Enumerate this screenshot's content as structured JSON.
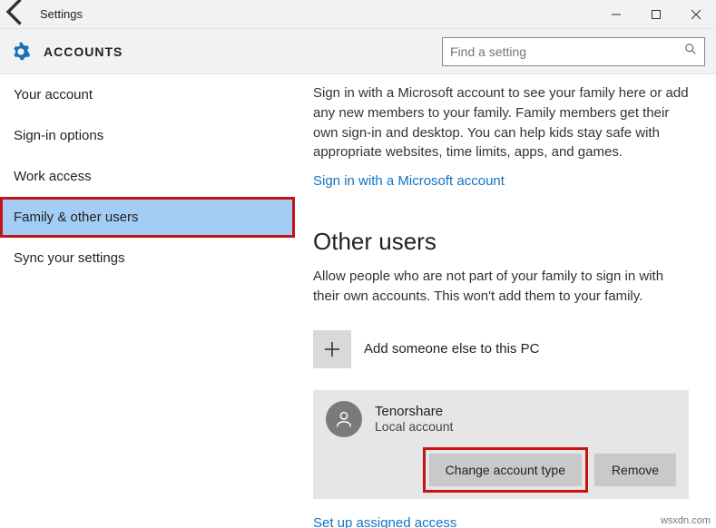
{
  "window": {
    "title": "Settings"
  },
  "header": {
    "category": "ACCOUNTS",
    "search_placeholder": "Find a setting"
  },
  "sidebar": {
    "items": [
      {
        "label": "Your account"
      },
      {
        "label": "Sign-in options"
      },
      {
        "label": "Work access"
      },
      {
        "label": "Family & other users"
      },
      {
        "label": "Sync your settings"
      }
    ]
  },
  "content": {
    "intro": "Sign in with a Microsoft account to see your family here or add any new members to your family. Family members get their own sign-in and desktop. You can help kids stay safe with appropriate websites, time limits, apps, and games.",
    "signin_link": "Sign in with a Microsoft account",
    "other_users_heading": "Other users",
    "other_users_sub": "Allow people who are not part of your family to sign in with their own accounts. This won't add them to your family.",
    "add_label": "Add someone else to this PC",
    "user": {
      "name": "Tenorshare",
      "type": "Local account"
    },
    "change_btn": "Change account type",
    "remove_btn": "Remove",
    "assigned_link": "Set up assigned access"
  },
  "watermark": "wsxdn.com"
}
